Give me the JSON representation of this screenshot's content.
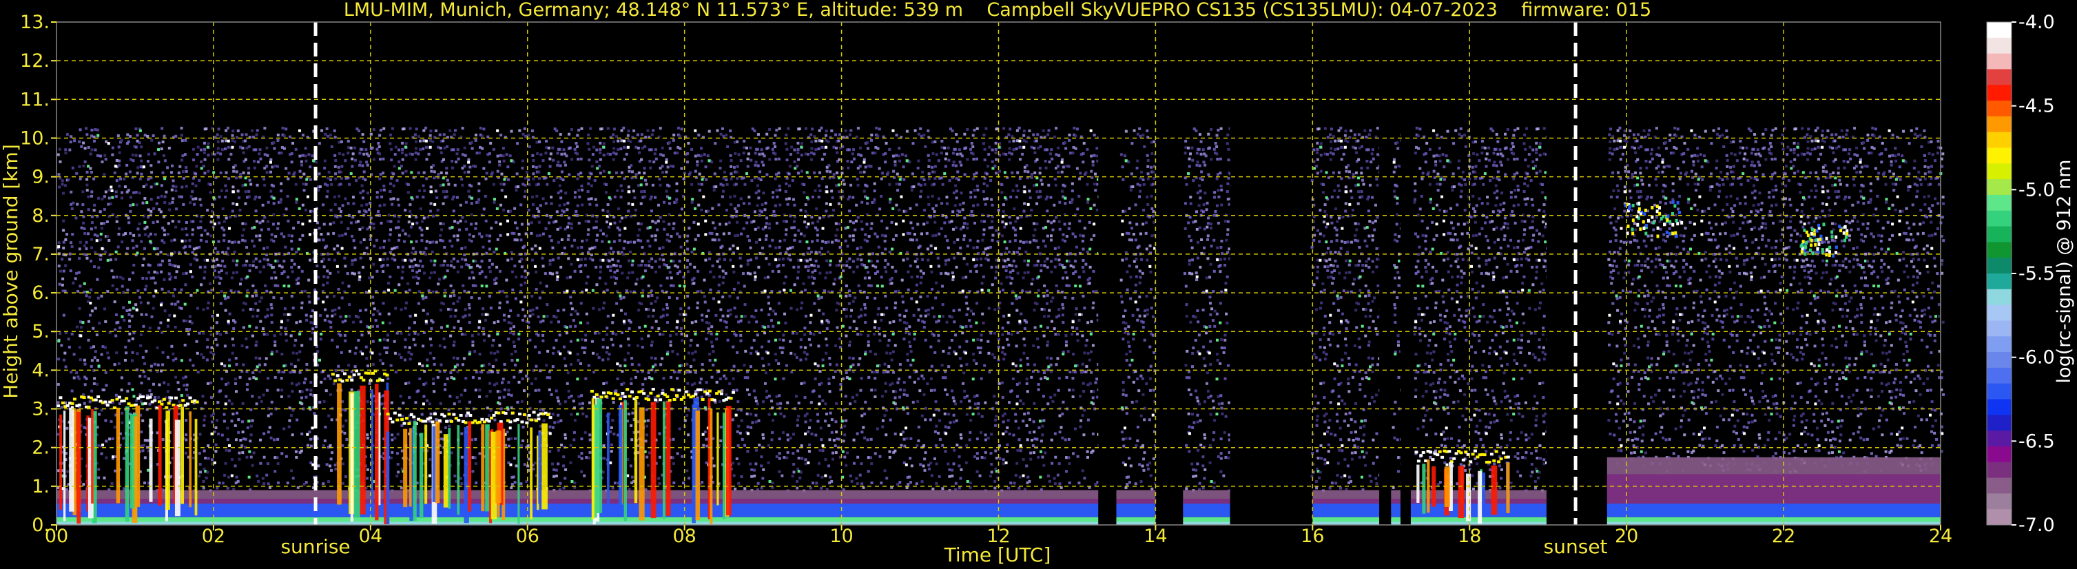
{
  "chart_data": {
    "type": "heatmap",
    "title": "LMU-MIM, Munich, Germany; 48.148° N 11.573° E, altitude: 539 m    Campbell SkyVUEPRO CS135 (CS135LMU): 04-07-2023    firmware: 015",
    "xlabel": "Time [UTC]",
    "ylabel": "Height above ground [km]",
    "xlim": [
      0,
      24
    ],
    "ylim": [
      0,
      13
    ],
    "x_ticks": [
      "00",
      "02",
      "04",
      "06",
      "08",
      "10",
      "12",
      "14",
      "16",
      "18",
      "20",
      "22",
      "24"
    ],
    "y_ticks": [
      "0.",
      "1.",
      "2.",
      "3.",
      "4.",
      "5.",
      "6.",
      "7.",
      "8.",
      "9.",
      "10.",
      "11.",
      "12.",
      "13."
    ],
    "grid": true,
    "colorbar": {
      "label": "log(rc-signal) @ 912 nm",
      "range": [
        -7.0,
        -4.0
      ],
      "ticks": [
        "-4.0",
        "-4.5",
        "-5.0",
        "-5.5",
        "-6.0",
        "-6.5",
        "-7.0"
      ],
      "colors": [
        "#ffffff",
        "#f3e4e4",
        "#f4b8b8",
        "#e34040",
        "#ff1a00",
        "#ff5a00",
        "#ff9900",
        "#ffd000",
        "#fff200",
        "#d6f000",
        "#a5e84a",
        "#5ee68a",
        "#34d27c",
        "#17b35a",
        "#0f9630",
        "#0d8a6a",
        "#1fa99a",
        "#8fd8e0",
        "#a7c8f4",
        "#9cb6f4",
        "#7f9ef2",
        "#6b86ea",
        "#4d6ff0",
        "#2b57f3",
        "#0f34f2",
        "#2020c8",
        "#5a1aa3",
        "#8a0a8f",
        "#7a2f7f",
        "#8a5c8a",
        "#9c7f9c",
        "#b08fab"
      ]
    },
    "events": [
      {
        "label": "sunrise",
        "time": 3.3
      },
      {
        "label": "sunset",
        "time": 19.35
      }
    ],
    "data_gaps": [
      [
        13.27,
        13.5
      ],
      [
        14.0,
        14.33
      ],
      [
        14.95,
        15.97
      ],
      [
        16.85,
        16.97
      ],
      [
        17.12,
        17.25
      ],
      [
        18.98,
        19.75
      ]
    ],
    "signal_top_km": 10.3,
    "low_clouds": [
      {
        "start": 0.0,
        "end": 1.8,
        "base_km": 3.2
      },
      {
        "start": 3.5,
        "end": 4.2,
        "base_km": 3.9
      },
      {
        "start": 4.2,
        "end": 6.3,
        "base_km": 2.8
      },
      {
        "start": 6.8,
        "end": 8.6,
        "base_km": 3.4
      },
      {
        "start": 17.3,
        "end": 18.5,
        "base_km": 1.8
      }
    ],
    "high_clouds": [
      {
        "start": 19.95,
        "end": 20.7,
        "base_km": 7.5
      },
      {
        "start": 22.2,
        "end": 22.8,
        "base_km": 7.0
      }
    ]
  }
}
